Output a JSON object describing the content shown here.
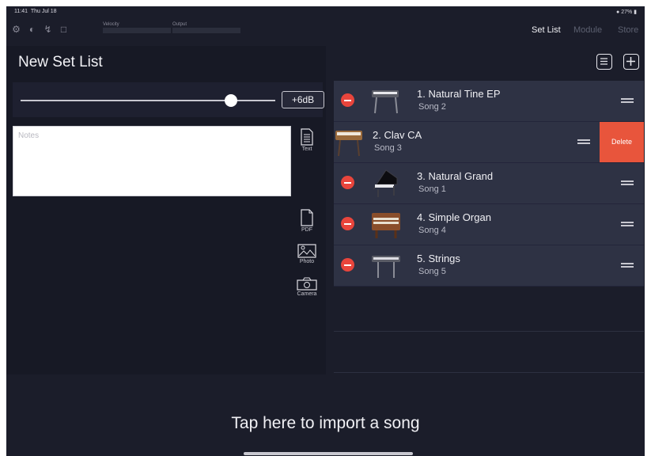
{
  "status_bar": {
    "time": "11:41",
    "date": "Thu Jul 18",
    "battery": "27%"
  },
  "toolbar": {
    "meters": [
      {
        "label": "Velocity"
      },
      {
        "label": "Output"
      }
    ],
    "tabs": [
      {
        "label": "Set List",
        "active": true
      },
      {
        "label": "Module",
        "active": false
      },
      {
        "label": "Store",
        "active": false
      }
    ]
  },
  "setlist": {
    "title": "New Set List",
    "gain_label": "+6dB",
    "notes_placeholder": "Notes",
    "attachments": [
      {
        "label": "Text",
        "icon": "text-doc-icon"
      },
      {
        "label": "PDF",
        "icon": "pdf-doc-icon"
      },
      {
        "label": "Photo",
        "icon": "photo-icon"
      },
      {
        "label": "Camera",
        "icon": "camera-icon"
      }
    ]
  },
  "songs": [
    {
      "name": "1. Natural Tine EP",
      "song": "Song 2",
      "swiped": false
    },
    {
      "name": "2. Clav CA",
      "song": "Song 3",
      "swiped": true
    },
    {
      "name": "3. Natural Grand",
      "song": "Song 1",
      "swiped": false
    },
    {
      "name": "4. Simple Organ",
      "song": "Song 4",
      "swiped": false
    },
    {
      "name": "5. Strings",
      "song": "Song 5",
      "swiped": false
    }
  ],
  "delete_label": "Delete",
  "import_label": "Tap here to import a song",
  "colors": {
    "background": "#1b1d2a",
    "row": "#2e3244",
    "delete": "#e8553c",
    "minus": "#e8453c"
  }
}
